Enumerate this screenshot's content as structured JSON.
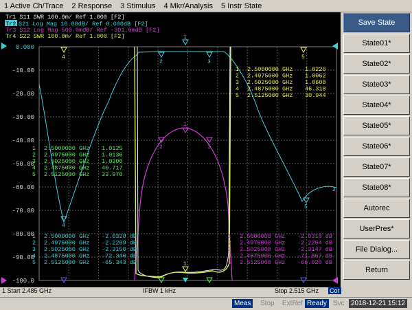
{
  "menu": [
    "1 Active Ch/Trace",
    "2 Response",
    "3 Stimulus",
    "4 Mkr/Analysis",
    "5 Instr State"
  ],
  "traces": [
    {
      "label": "Tr1 S11 SWR 100.0m/ Ref 1.000 [F2]",
      "color": "#f0f0f0"
    },
    {
      "label": "Tr2 S21 Log Mag 10.00dB/ Ref 0.000dB [F2]",
      "color": "#40d0d8",
      "active_tag": "Tr2"
    },
    {
      "label": "Tr3 S12 Log Mag 500.0mdB/ Ref -301.0mdB [F2]",
      "color": "#d040d8"
    },
    {
      "label": "Tr4 S22 SWR 100.0m/ Ref 1.000 [F2]",
      "color": "#d0f060"
    }
  ],
  "yaxis": [
    "0.000",
    "-10.00",
    "-20.00",
    "-30.00",
    "-40.00",
    "-50.00",
    "-60.00",
    "-70.00",
    "-80.00",
    "-90.00",
    "-100.0"
  ],
  "marker_tables": {
    "tr2": {
      "color": "#f0f060",
      "rows": [
        {
          "n": "1",
          "freq": "2.5000000 GHz",
          "val": "1.0226"
        },
        {
          "n": "2",
          "freq": "2.4975000 GHz",
          "val": "1.0062"
        },
        {
          "n": "3",
          "freq": "2.5025000 GHz",
          "val": "1.0608"
        },
        {
          "n": "4",
          "freq": "2.4875000 GHz",
          "val": "46.318"
        },
        {
          "n": "5",
          "freq": "2.5125000 GHz",
          "val": "30.944"
        }
      ]
    },
    "tr1": {
      "color": "#60f060",
      "rows": [
        {
          "n": "1",
          "freq": "2.5000000 GHz",
          "val": "1.0125"
        },
        {
          "n": "2",
          "freq": "2.4975000 GHz",
          "val": "1.0136"
        },
        {
          "n": "3",
          "freq": "2.5025000 GHz",
          "val": "1.0300"
        },
        {
          "n": "4",
          "freq": "2.4875000 GHz",
          "val": "40.717"
        },
        {
          "n": "5",
          "freq": "2.5125000 GHz",
          "val": "33.970"
        }
      ]
    },
    "left_db": {
      "color": "#40d0d8",
      "rows": [
        {
          "n": "1",
          "freq": "2.5000000 GHz",
          "val": "-2.0328 dB"
        },
        {
          "n": "2",
          "freq": "2.4975000 GHz",
          "val": "-2.2209 dB"
        },
        {
          "n": "3",
          "freq": "2.5025000 GHz",
          "val": "-2.3150 dB"
        },
        {
          "n": "4",
          "freq": "2.4875000 GHz",
          "val": "-72.340 dB"
        },
        {
          "n": "5",
          "freq": "2.5125000 GHz",
          "val": "-65.343 dB"
        }
      ]
    },
    "right_db": {
      "color": "#d040d8",
      "rows": [
        {
          "n": "1",
          "freq": "2.5000000 GHz",
          "val": "-2.0318 dB"
        },
        {
          "n": "2",
          "freq": "2.4975000 GHz",
          "val": "-2.2264 dB"
        },
        {
          "n": "3",
          "freq": "2.5025000 GHz",
          "val": "-2.3147 dB"
        },
        {
          "n": "4",
          "freq": "2.4875000 GHz",
          "val": "-71.867 dB"
        },
        {
          "n": "5",
          "freq": "2.5125000 GHz",
          "val": "-66.020 dB"
        }
      ]
    }
  },
  "channel": {
    "start": "1  Start 2.485 GHz",
    "ifbw": "IFBW 1 kHz",
    "stop": "Stop 2.515 GHz"
  },
  "softkeys": [
    "Save State",
    "State01*",
    "State02*",
    "State03*",
    "State04*",
    "State05*",
    "State06*",
    "State07*",
    "State08*",
    "Autorec",
    "UserPres*",
    "File Dialog...",
    "Return"
  ],
  "status": {
    "meas": "Meas",
    "stop": "Stop",
    "extref": "ExtRef",
    "ready": "Ready",
    "svc": "Svc",
    "datetime": "2018-12-21 15:12"
  },
  "colors": {
    "s21": "#40d0d8",
    "s12": "#d040d8",
    "s11": "#f0f0f0",
    "s22": "#d0f060",
    "grid": "#606060",
    "ready": "#003080"
  }
}
